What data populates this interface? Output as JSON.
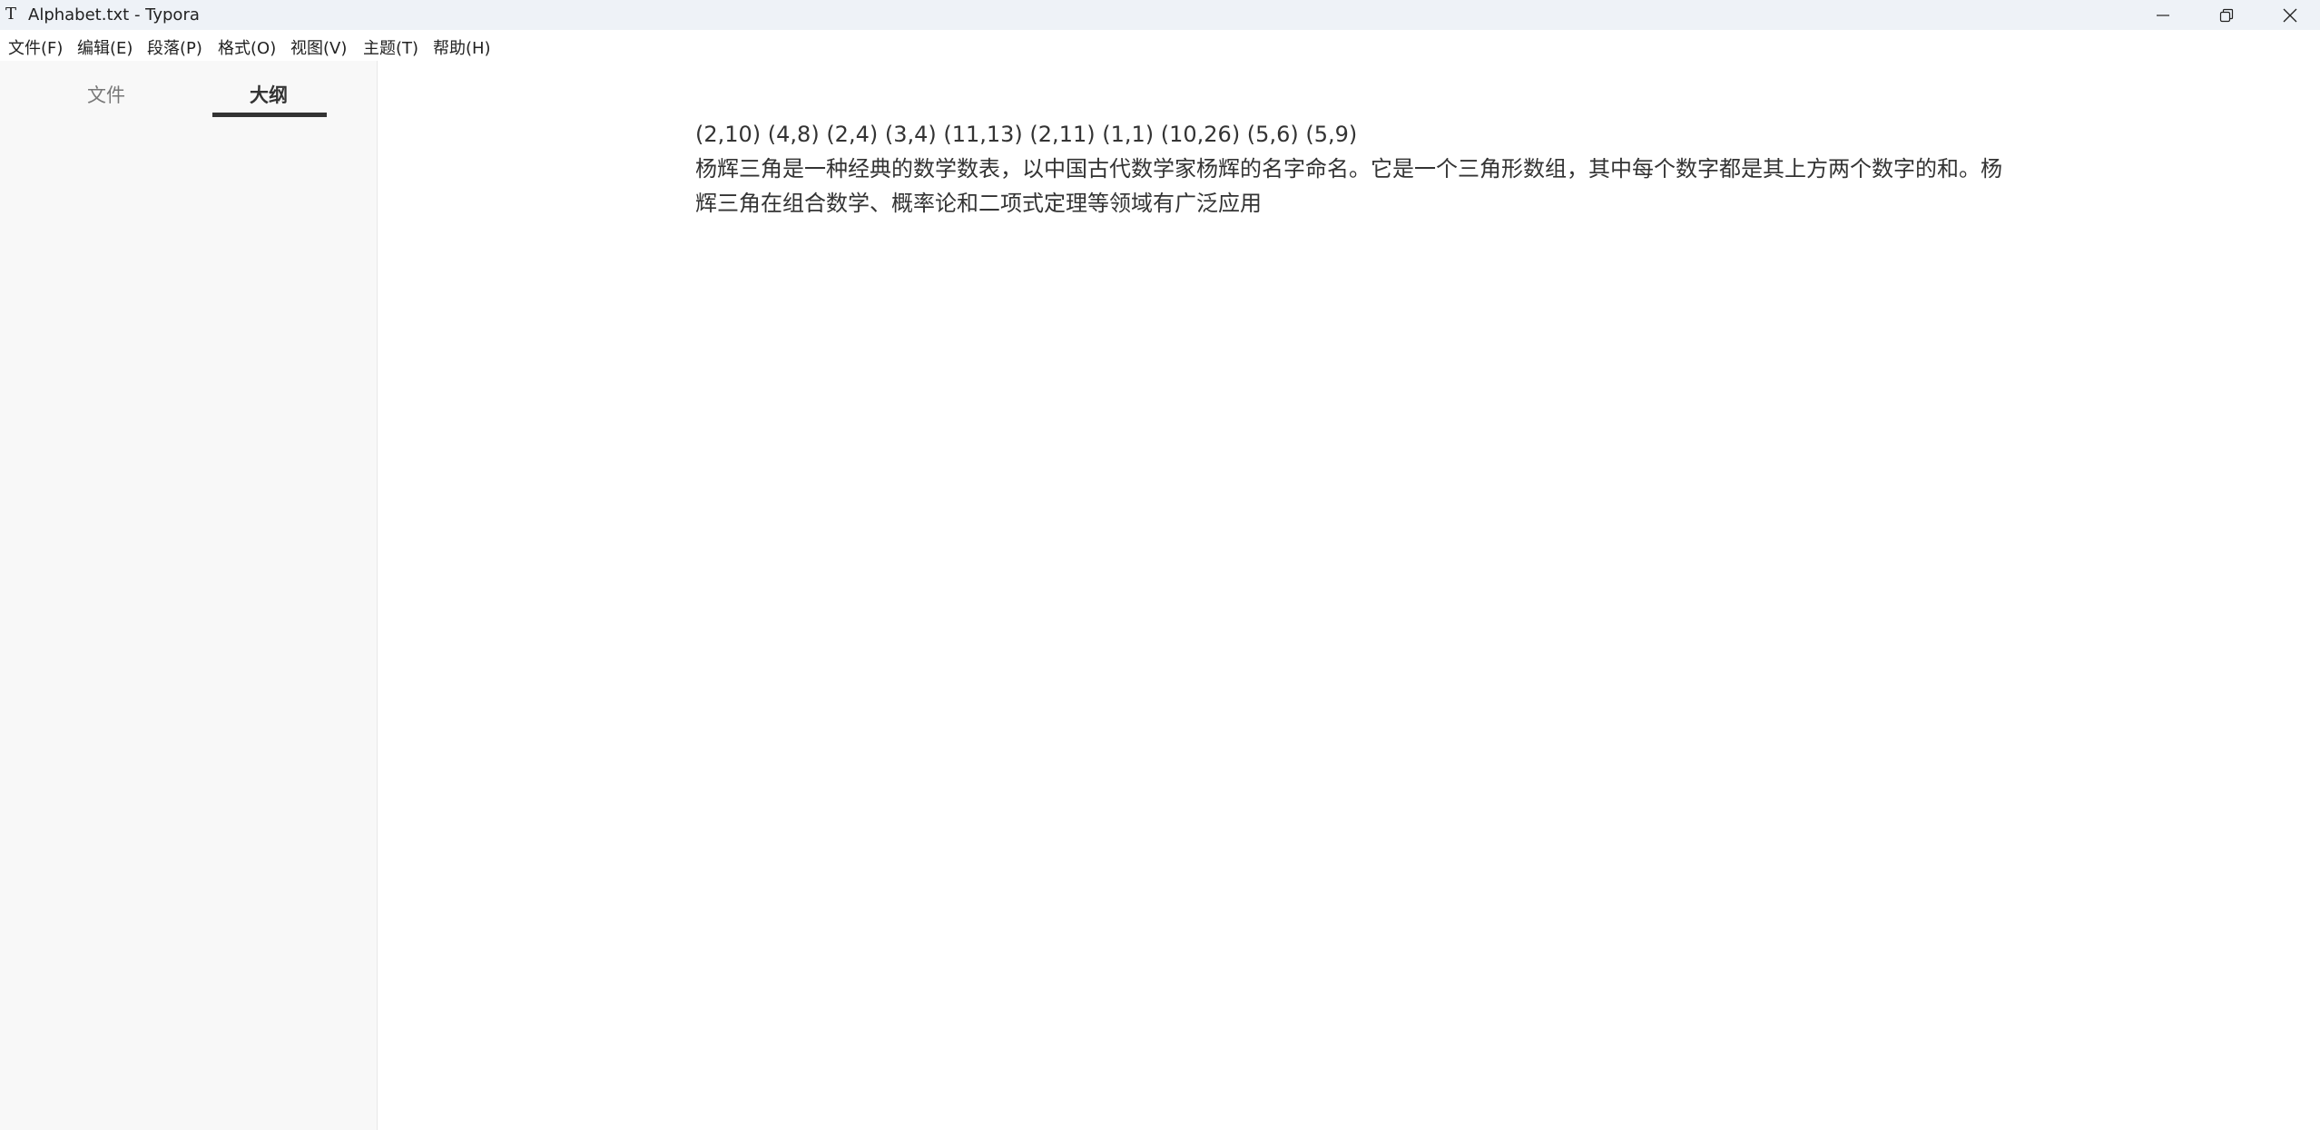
{
  "window": {
    "app_icon": "T",
    "title": "Alphabet.txt - Typora"
  },
  "menu": {
    "items": [
      {
        "label": "文件(F)"
      },
      {
        "label": "编辑(E)"
      },
      {
        "label": "段落(P)"
      },
      {
        "label": "格式(O)"
      },
      {
        "label": "视图(V)"
      },
      {
        "label": "主题(T)"
      },
      {
        "label": "帮助(H)"
      }
    ]
  },
  "sidebar": {
    "tabs": [
      {
        "label": "文件",
        "active": false
      },
      {
        "label": "大纲",
        "active": true
      }
    ]
  },
  "document": {
    "line1": "(2,10) (4,8) (2,4) (3,4) (11,13) (2,11) (1,1) (10,26) (5,6) (5,9)",
    "line2": "杨辉三角是一种经典的数学数表，以中国古代数学家杨辉的名字命名。它是一个三角形数组，其中每个数字都是其上方两个数字的和。杨辉三角在组合数学、概率论和二项式定理等领域有广泛应用"
  },
  "icons": {
    "minimize": "minimize-icon",
    "maximize": "restore-icon",
    "close": "close-icon"
  }
}
